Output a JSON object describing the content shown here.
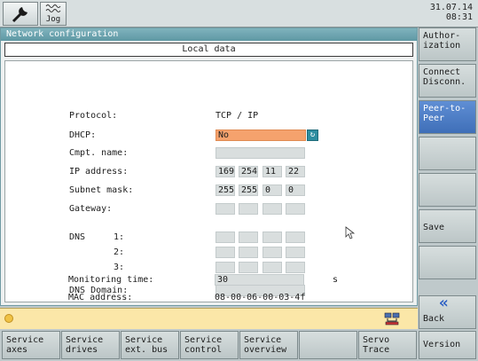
{
  "topbar": {
    "jog_label": "Jog",
    "date": "31.07.14",
    "time": "08:31"
  },
  "window": {
    "title": "Network configuration",
    "section_header": "Local data"
  },
  "form": {
    "protocol_label": "Protocol:",
    "protocol_value": "TCP / IP",
    "dhcp_label": "DHCP:",
    "dhcp_value": "No",
    "computer_name_label": "Cmpt. name:",
    "computer_name_value": "",
    "ip_label": "IP address:",
    "ip": [
      "169",
      "254",
      "11",
      "22"
    ],
    "subnet_label": "Subnet mask:",
    "subnet": [
      "255",
      "255",
      "0",
      "0"
    ],
    "gateway_label": "Gateway:",
    "gateway": [
      "",
      "",
      "",
      ""
    ],
    "dns_label": "DNS",
    "dns_1_label": "1:",
    "dns_2_label": "2:",
    "dns_3_label": "3:",
    "dns_domain_label": "DNS Domain:",
    "dns_domain_value": "",
    "monitoring_label": "Monitoring time:",
    "monitoring_value": "30",
    "monitoring_unit": "s",
    "mac_label": "MAC address:",
    "mac_value": "08-00-06-00-03-4f"
  },
  "right_softkeys": {
    "authorization": "Author-\nization",
    "connect": "Connect\nDisconn.",
    "peer": "Peer-to-\nPeer",
    "save": "Save",
    "back": "Back",
    "version": "Version"
  },
  "bottom_softkeys": {
    "service_axes": "Service\naxes",
    "service_drives": "Service\ndrives",
    "service_ext_bus": "Service\next. bus",
    "service_control": "Service\ncontrol",
    "service_overview": "Service\noverview",
    "servo_trace": "Servo\nTrace"
  },
  "colors": {
    "title_bar": "#6fa6b1",
    "dhcp_field": "#f5a26d",
    "active_softkey": "#4f7fc6",
    "status_bar": "#fbe7a8"
  },
  "icons": {
    "wrench": "wrench-icon",
    "jog": "jog-wave-icon",
    "dhcp_toggle": "toggle-cycle-icon",
    "network": "network-computers-icon",
    "back": "double-chevron-up-icon"
  }
}
